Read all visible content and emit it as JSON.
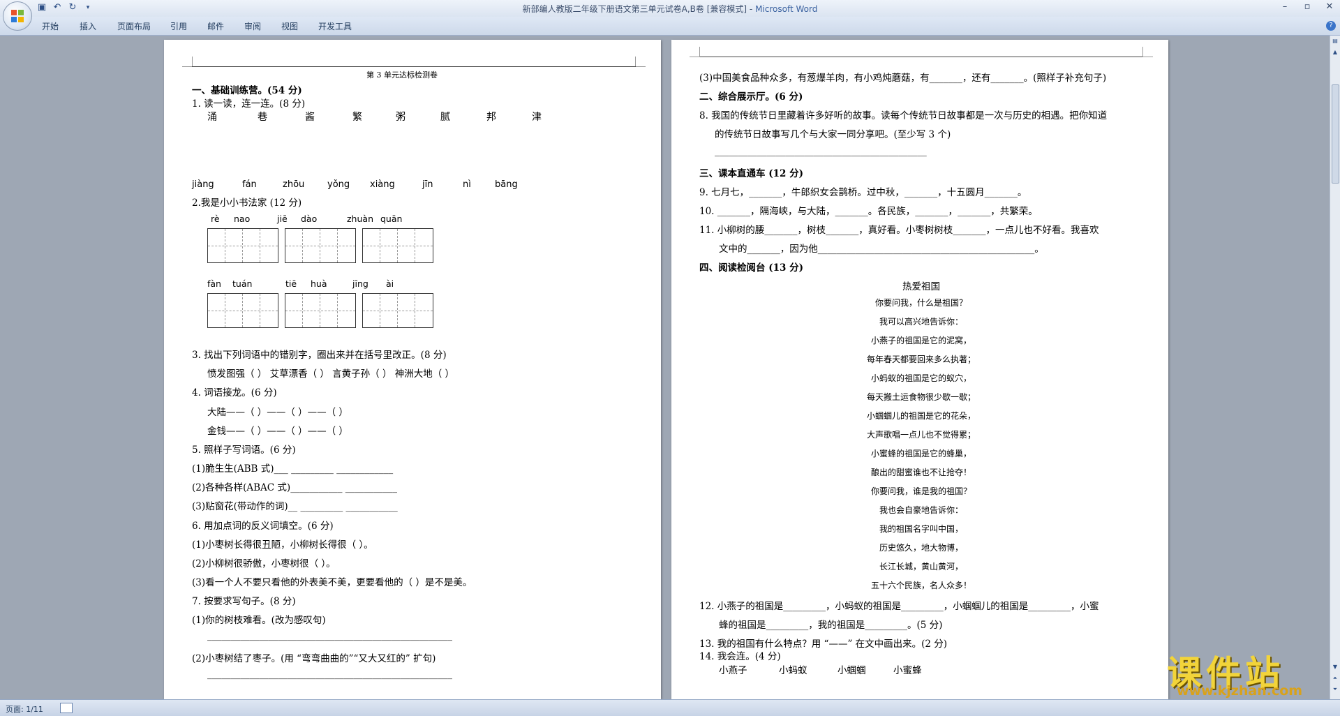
{
  "window": {
    "title": "新部编人教版二年级下册语文第三单元试卷A,B卷 [兼容模式] - ",
    "app_name": "Microsoft Word"
  },
  "ribbon_tabs": [
    "开始",
    "插入",
    "页面布局",
    "引用",
    "邮件",
    "审阅",
    "视图",
    "开发工具"
  ],
  "status": {
    "page": "页面: 1/11"
  },
  "watermark": {
    "main": "课件站",
    "url": "www.kjzhan.com"
  },
  "page1": {
    "header": "第 3 单元达标检测卷",
    "sec1": "一、基础训练营。(54 分)",
    "q1": "1. 读一读，连一连。(8 分)",
    "q1_chars": [
      "涌",
      "巷",
      "酱",
      "繁",
      "粥",
      "腻",
      "邦",
      "津"
    ],
    "q1_pinyin": [
      "jiàng",
      "fán",
      "zhōu",
      "yǒng",
      "xiàng",
      "jīn",
      "nì",
      "bāng"
    ],
    "q2": "2.我是小小书法家 (12 分)",
    "q2_py_row1": [
      "rè",
      "nao",
      "jiē",
      "dào",
      "zhuàn",
      "quān"
    ],
    "q2_py_row2": [
      "fàn",
      "tuán",
      "tiē",
      "huà",
      "jīng",
      "ài"
    ],
    "q3": "3. 找出下列词语中的错别字，圈出来并在括号里改正。(8 分)",
    "q3_items": "愤发图强（     ）   艾草漂香（     ）   言黄子孙（     ）   神洲大地（     ）",
    "q4": "4. 词语接龙。(6 分)",
    "q4_row1": "大陆——（          ）——（          ）——（          ）",
    "q4_row2": "金钱——（          ）——（          ）——（          ）",
    "q5": "5. 照样子写词语。(6 分)",
    "q5_1": "(1)脆生生(ABB 式)___ _________      ____________",
    "q5_2": "(2)各种各样(ABAC 式)___________      ___________",
    "q5_3": "(3)贴窗花(带动作的词)__ _________      ___________",
    "q6": "6. 用加点词的反义词填空。(6 分)",
    "q6_1": "(1)小枣树长得很丑陋，小柳树长得很（        ）。",
    "q6_2": "(2)小柳树很骄傲，小枣树很（        ）。",
    "q6_3": "(3)看一个人不要只看他的外表美不美，更要看他的（        ）是不是美。",
    "q7": "7. 按要求写句子。(8 分)",
    "q7_1": "(1)你的树枝难看。(改为感叹句)",
    "q7_blank1": "____________________________________________________",
    "q7_2": "(2)小枣树结了枣子。(用 “弯弯曲曲的”“又大又红的” 扩句)",
    "q7_blank2": "____________________________________________________"
  },
  "page2": {
    "q7_3": "(3)中国美食品种众多，有葱爆羊肉，有小鸡炖蘑菇，有_______，还有_______。(照样子补充句子)",
    "sec2": "二、综合展示厅。(6 分)",
    "q8a": "8. 我国的传统节日里藏着许多好听的故事。读每个传统节日故事都是一次与历史的相遇。把你知道",
    "q8b": "的传统节日故事写几个与大家一同分享吧。(至少写 3 个)",
    "q8_blank": "_____________________________________________",
    "sec3": "三、课本直通车 (12 分)",
    "q9": "9. 七月七，_______，牛郎织女会鹊桥。过中秋，_______，十五圆月_______。",
    "q10": "10. _______，隔海峡，与大陆，_______。各民族，_______，_______，共繁荣。",
    "q11a": "11. 小柳树的腰_______，树枝_______，真好看。小枣树树枝_______，一点儿也不好看。我喜欢",
    "q11b": "文中的_______，因为他______________________________________________。",
    "sec4": "四、阅读检阅台 (13 分)",
    "poem_title": "热爱祖国",
    "poem": [
      "你要问我，什么是祖国？",
      "我可以高兴地告诉你：",
      "小燕子的祖国是它的泥窝，",
      "每年春天都要回来多么执著；",
      "小蚂蚁的祖国是它的蚁穴，",
      "每天搬土运食物很少歇一歇；",
      "小蝈蝈儿的祖国是它的花朵，",
      "大声歌唱一点儿也不觉得累；",
      "小蜜蜂的祖国是它的蜂巢，",
      "酿出的甜蜜谁也不让抢夺！",
      "你要问我，谁是我的祖国？",
      "我也会自豪地告诉你：",
      "我的祖国名字叫中国，",
      "历史悠久，地大物博，",
      "长江长城，黄山黄河，",
      "五十六个民族，名人众多！"
    ],
    "q12a": "12. 小燕子的祖国是_________，小蚂蚁的祖国是_________，小蝈蝈儿的祖国是_________，小蜜",
    "q12b": "蜂的祖国是_________，我的祖国是_________。(5 分)",
    "q13": "13. 我的祖国有什么特点？用 “——” 在文中画出来。(2 分)",
    "q14": "14. 我会连。(4 分)",
    "q14_items": [
      "小燕子",
      "小蚂蚁",
      "小蝈蝈",
      "小蜜蜂"
    ]
  }
}
